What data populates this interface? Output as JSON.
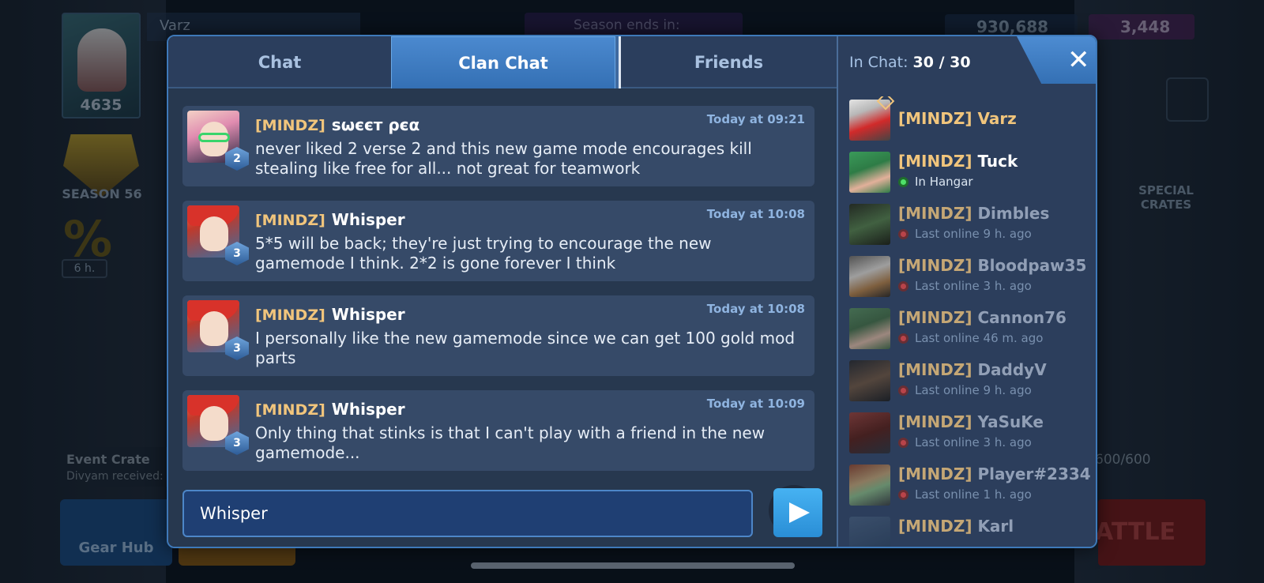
{
  "background": {
    "player_name": "Varz",
    "rating": "4635",
    "season_label": "SEASON 56",
    "timer": "6 h.",
    "season_ends": "Season ends in:",
    "currency_coins": "930,688",
    "currency_gems": "3,448",
    "special_crates": "SPECIAL CRATES",
    "event_crate": "Event Crate",
    "event_sub": "Divyam received:",
    "gear_hub": "Gear Hub",
    "limit": "600/600",
    "battle": "ATTLE"
  },
  "tabs": [
    {
      "label": "Chat"
    },
    {
      "label": "Clan Chat",
      "active": true
    },
    {
      "label": "Friends"
    }
  ],
  "messages": [
    {
      "clan": "[MINDZ]",
      "name": "ѕωєєт ρєα",
      "time": "Today at 09:21",
      "level": "2",
      "text": "never liked 2 verse 2 and this new game mode encourages kill stealing like free for all... not great for teamwork"
    },
    {
      "clan": "[MINDZ]",
      "name": "Whisper",
      "time": "Today at 10:08",
      "level": "3",
      "text": "5*5 will be back; they're just trying to encourage the new gamemode I think. 2*2 is gone forever I think"
    },
    {
      "clan": "[MINDZ]",
      "name": "Whisper",
      "time": "Today at 10:08",
      "level": "3",
      "text": "I personally like the new gamemode since we can get 100 gold mod parts"
    },
    {
      "clan": "[MINDZ]",
      "name": "Whisper",
      "time": "Today at 10:09",
      "level": "3",
      "text": "Only thing that stinks is that I can't play with a friend in the new gamemode..."
    }
  ],
  "input": {
    "value": "Whisper",
    "placeholder": ""
  },
  "in_chat": {
    "label": "In Chat:",
    "count": "30 / 30"
  },
  "members": [
    {
      "clan": "[MINDZ]",
      "name": "Varz",
      "status": ""
    },
    {
      "clan": "[MINDZ]",
      "name": "Tuck",
      "status": "In Hangar"
    },
    {
      "clan": "[MINDZ]",
      "name": "Dimbles",
      "status": "Last online 9 h.  ago"
    },
    {
      "clan": "[MINDZ]",
      "name": "Bloodpaw35",
      "status": "Last online 3 h.  ago"
    },
    {
      "clan": "[MINDZ]",
      "name": "Cannon76",
      "status": "Last online 46 m.  ago"
    },
    {
      "clan": "[MINDZ]",
      "name": "DaddyV",
      "status": "Last online 9 h.  ago"
    },
    {
      "clan": "[MINDZ]",
      "name": "YaSuKe",
      "status": "Last online 3 h.  ago"
    },
    {
      "clan": "[MINDZ]",
      "name": "Player#2334",
      "status": "Last online 1 h.  ago"
    },
    {
      "clan": "[MINDZ]",
      "name": "Karl",
      "status": ""
    }
  ],
  "colors": {
    "accent": "#3e79b9",
    "clan_tag": "#f1c57c",
    "active_tab": "#3470b4",
    "send": "#2a8ed6"
  },
  "icons": {
    "close": "close-icon",
    "send": "send-icon",
    "scroll": "chevron-down-icon"
  }
}
